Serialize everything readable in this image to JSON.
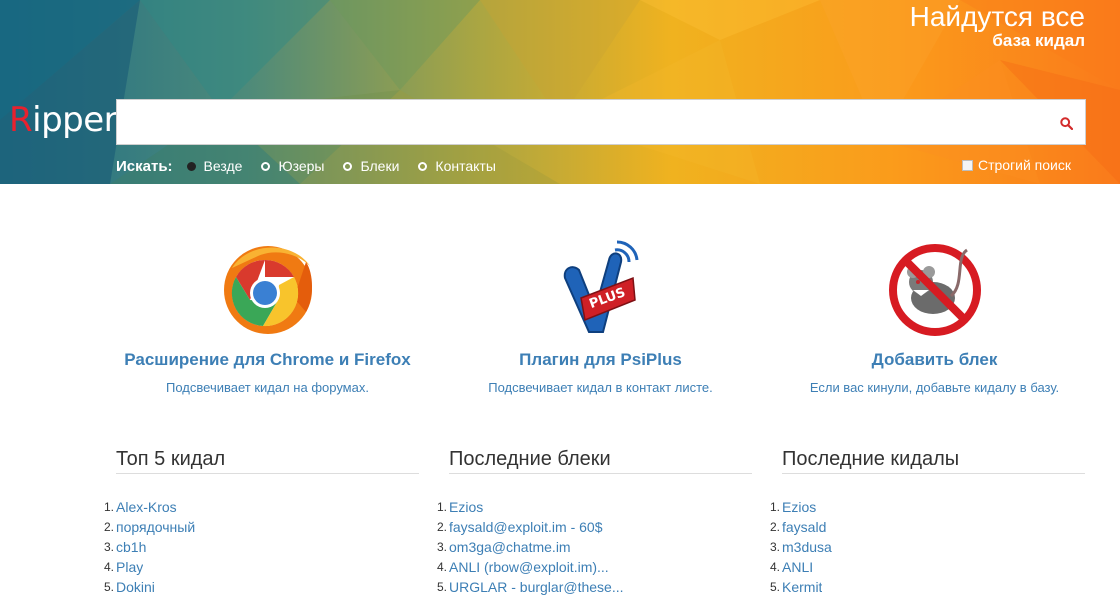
{
  "header": {
    "logo_first": "R",
    "logo_rest": "ipper",
    "tagline_big": "Найдутся все",
    "tagline_small": "база кидал"
  },
  "search": {
    "value": "",
    "placeholder": "",
    "icon": "search-icon"
  },
  "filters": {
    "label": "Искать:",
    "options": [
      {
        "label": "Везде",
        "checked": true
      },
      {
        "label": "Юзеры",
        "checked": false
      },
      {
        "label": "Блеки",
        "checked": false
      },
      {
        "label": "Контакты",
        "checked": false
      }
    ],
    "strict_label": "Строгий поиск",
    "strict_checked": false
  },
  "features": [
    {
      "title": "Расширение для Chrome и Firefox",
      "desc": "Подсвечивает кидал на форумах.",
      "icon": "chrome-firefox-icon"
    },
    {
      "title": "Плагин для PsiPlus",
      "desc": "Подсвечивает кидал в контакт листе.",
      "icon": "psiplus-icon"
    },
    {
      "title": "Добавить блек",
      "desc": "Если вас кинули, добавьте кидалу в базу.",
      "icon": "no-rat-icon"
    }
  ],
  "lists": {
    "top": {
      "title": "Топ 5 кидал",
      "items": [
        {
          "num": "1.",
          "text": "Alex-Kros"
        },
        {
          "num": "2.",
          "text": "порядочный"
        },
        {
          "num": "3.",
          "text": "cb1h"
        },
        {
          "num": "4.",
          "text": "Play"
        },
        {
          "num": "5.",
          "text": "Dokini"
        }
      ]
    },
    "blacks": {
      "title": "Последние блеки",
      "items": [
        {
          "num": "1.",
          "text": "Ezios"
        },
        {
          "num": "2.",
          "text": "faysald@exploit.im - 60$"
        },
        {
          "num": "3.",
          "text": "om3ga@chatme.im"
        },
        {
          "num": "4.",
          "text": "ANLI (rbow@exploit.im)..."
        },
        {
          "num": "5.",
          "text": "URGLAR - burglar@these..."
        }
      ]
    },
    "scammers": {
      "title": "Последние кидалы",
      "items": [
        {
          "num": "1.",
          "text": "Ezios"
        },
        {
          "num": "2.",
          "text": "faysald"
        },
        {
          "num": "3.",
          "text": "m3dusa"
        },
        {
          "num": "4.",
          "text": "ANLI"
        },
        {
          "num": "5.",
          "text": "Kermit"
        }
      ]
    }
  },
  "colors": {
    "link": "#3d7fb5",
    "logo_accent": "#e8212e"
  }
}
